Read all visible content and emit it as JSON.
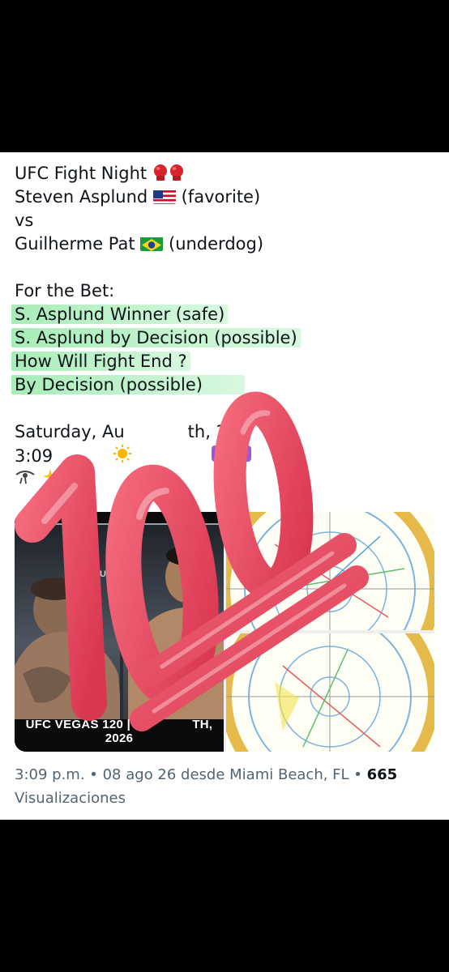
{
  "post": {
    "line1": "UFC Fight Night",
    "line1_emoji": "🥊🥊",
    "line2_name": "Steven Asplund",
    "line2_flag": "us-flag",
    "line2_tag": "(favorite)",
    "line3": "vs",
    "line4_name": "Guilherme Pat",
    "line4_flag": "brazil-flag",
    "line4_tag": "(underdog)",
    "bet_header": "For the Bet:",
    "bet_lines": [
      "S. Asplund Winner (safe)",
      "S. Asplund by Decision (possible)",
      "How Will Fight End ?",
      "By Decision (possible)"
    ],
    "date_partial": "Saturday, Au",
    "date_partial2": "th, 2",
    "date_partial3": "6",
    "time_partial": "3:09",
    "highlight_color": "#8ae6a0"
  },
  "media": {
    "poster_caption": "UFC VEGAS 120 | AU",
    "poster_caption_end": "TH, 2026",
    "poster_logo": "UFC"
  },
  "meta": {
    "timestamp": "3:09 p.m. • 08 ago 26 desde Miami Beach, FL •",
    "views_count": "665",
    "views_label": "Visualizaciones"
  },
  "overlay": {
    "sticker": "hundred-points-icon",
    "sticker_color": "#e8435a"
  }
}
